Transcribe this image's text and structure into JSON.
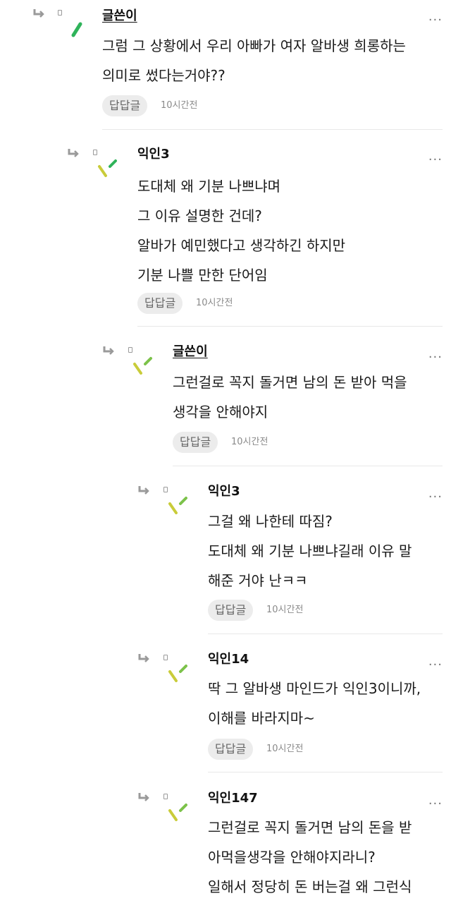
{
  "comments": [
    {
      "author": "글쓴이",
      "lines": [
        "그럼 그 상황에서 우리 아빠가 여자 알바생 희롱하는",
        "의미로 썼다는거야??"
      ],
      "reply_label": "답답글",
      "time": "10시간전"
    },
    {
      "author": "익인3",
      "lines": [
        "도대체 왜 기분 나쁘냐며",
        "그 이유 설명한 건데?",
        "알바가 예민했다고 생각하긴 하지만",
        "기분 나쁠 만한 단어임"
      ],
      "reply_label": "답답글",
      "time": "10시간전"
    },
    {
      "author": "글쓴이",
      "lines": [
        "그런걸로 꼭지 돌거면 남의 돈 받아 먹을",
        "생각을 안해야지"
      ],
      "reply_label": "답답글",
      "time": "10시간전"
    },
    {
      "author": "익인3",
      "lines": [
        "그걸 왜 나한테 따짐?",
        "도대체 왜 기분 나쁘냐길래 이유 말",
        "해준 거야 난ㅋㅋ"
      ],
      "reply_label": "답답글",
      "time": "10시간전"
    },
    {
      "author": "익인14",
      "lines": [
        "딱 그 알바생 마인드가 익인3이니까,",
        "이해를 바라지마~"
      ],
      "reply_label": "답답글",
      "time": "10시간전"
    },
    {
      "author": "익인147",
      "lines": [
        "그런걸로 꼭지 돌거면 남의 돈을 받",
        "아먹을생각을 안해야지라니?",
        "일해서 정당히 돈 버는걸 왜 그런식"
      ],
      "reply_label": "",
      "time": ""
    }
  ],
  "more_label": "···",
  "colors": {
    "avatar_green": "#2fb35a",
    "avatar_yellow": "#c9cc3a",
    "avatar_lightgreen": "#7cc24a",
    "reply_btn_bg": "#ececec"
  }
}
